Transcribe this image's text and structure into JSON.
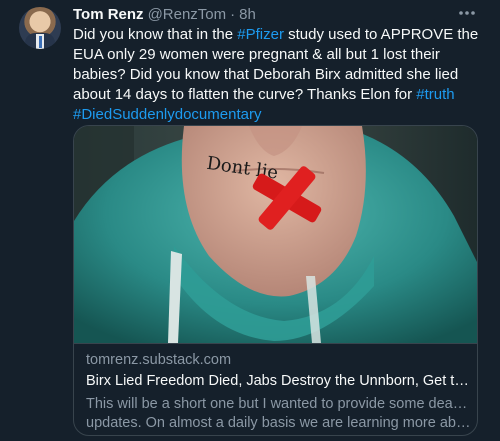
{
  "tweet": {
    "author_name": "Tom Renz",
    "handle": "@RenzTom",
    "separator": "·",
    "time": "8h",
    "more_icon": "more-horizontal-icon",
    "text": {
      "t1": "Did you know that in the ",
      "h1": "#Pfizer",
      "t2": " study used to APPROVE the EUA only 29 women were pregnant & all but 1 lost their babies? Did you know that Deborah Birx admitted she lied about 14 days to flatten the curve? Thanks Elon for ",
      "h2": "#truth",
      "h3": "#DiedSuddenlydocumentary"
    },
    "link_color": "#1d9bf0"
  },
  "card": {
    "image_caption": "Dont lie",
    "domain": "tomrenz.substack.com",
    "title": "Birx Lied Freedom Died, Jabs Destroy the Unnborn, Get the ...",
    "description_line1": "This will be a short one but I wanted to provide some deathjab",
    "description_line2": "updates. On almost a daily basis we are learning more about..."
  }
}
